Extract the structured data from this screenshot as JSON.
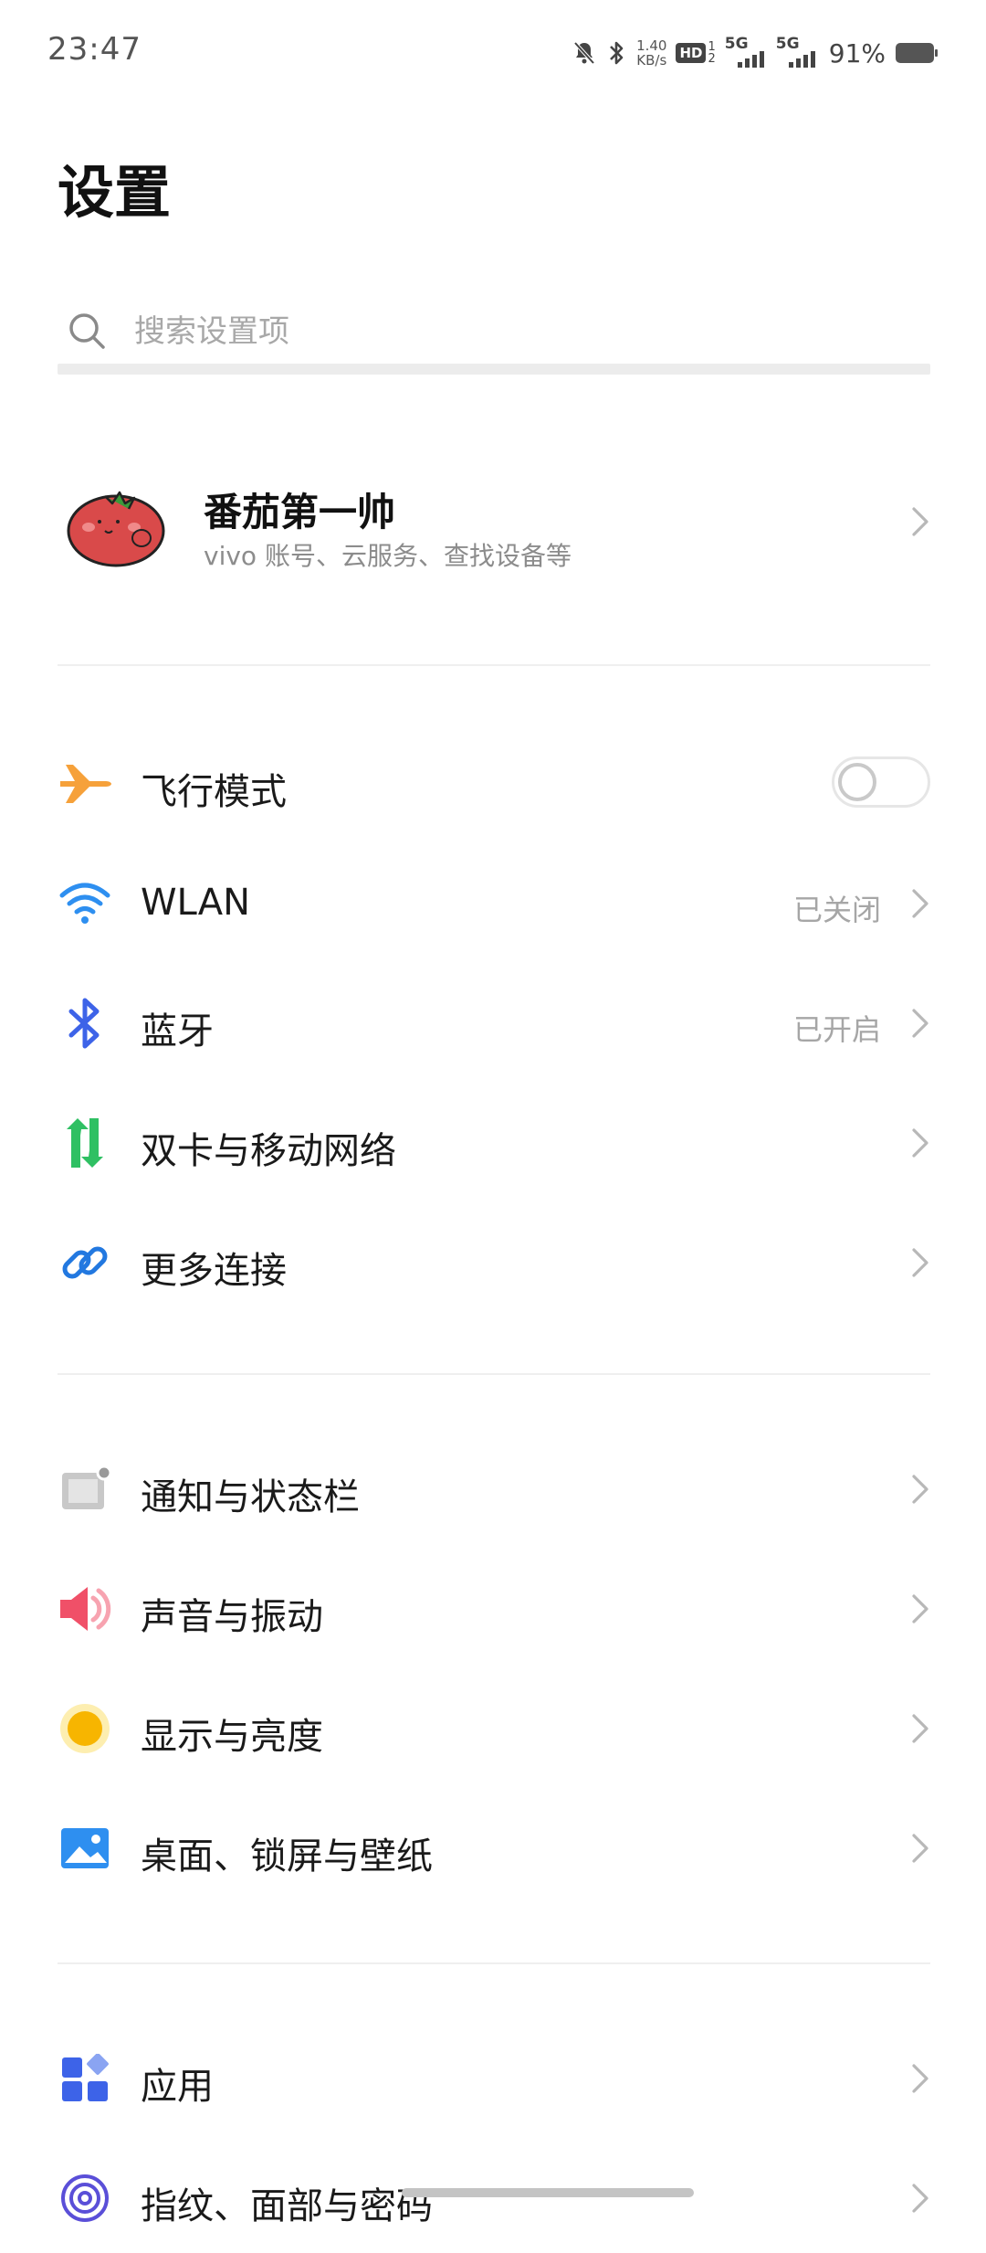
{
  "status_bar": {
    "time": "23:47",
    "speed_value": "1.40",
    "speed_unit": "KB/s",
    "hd_label": "HD",
    "net1": "5G",
    "net2": "5G",
    "battery": "91%"
  },
  "title": "设置",
  "search": {
    "placeholder": "搜索设置项"
  },
  "profile": {
    "name": "番茄第一帅",
    "subtitle": "vivo 账号、云服务、查找设备等"
  },
  "rows": [
    {
      "label": "飞行模式",
      "icon": "airplane-icon",
      "type": "toggle",
      "on": false,
      "color": "#f6a13a"
    },
    {
      "label": "WLAN",
      "icon": "wifi-icon",
      "value": "已关闭",
      "color": "#2e8ff0"
    },
    {
      "label": "蓝牙",
      "icon": "bluetooth-icon",
      "value": "已开启",
      "color": "#3d63e8"
    },
    {
      "label": "双卡与移动网络",
      "icon": "mobile-data-icon",
      "color": "#2fc063"
    },
    {
      "label": "更多连接",
      "icon": "link-icon",
      "color": "#2278e0"
    },
    {
      "label": "通知与状态栏",
      "icon": "notification-icon",
      "color": "#9a9a9a"
    },
    {
      "label": "声音与振动",
      "icon": "sound-icon",
      "color": "#f05068"
    },
    {
      "label": "显示与亮度",
      "icon": "brightness-icon",
      "color": "#f7b500"
    },
    {
      "label": "桌面、锁屏与壁纸",
      "icon": "wallpaper-icon",
      "color": "#2e8ff0"
    },
    {
      "label": "应用",
      "icon": "apps-icon",
      "color": "#3d63e8"
    },
    {
      "label": "指纹、面部与密码",
      "icon": "fingerprint-icon",
      "color": "#5a4fd8"
    }
  ]
}
